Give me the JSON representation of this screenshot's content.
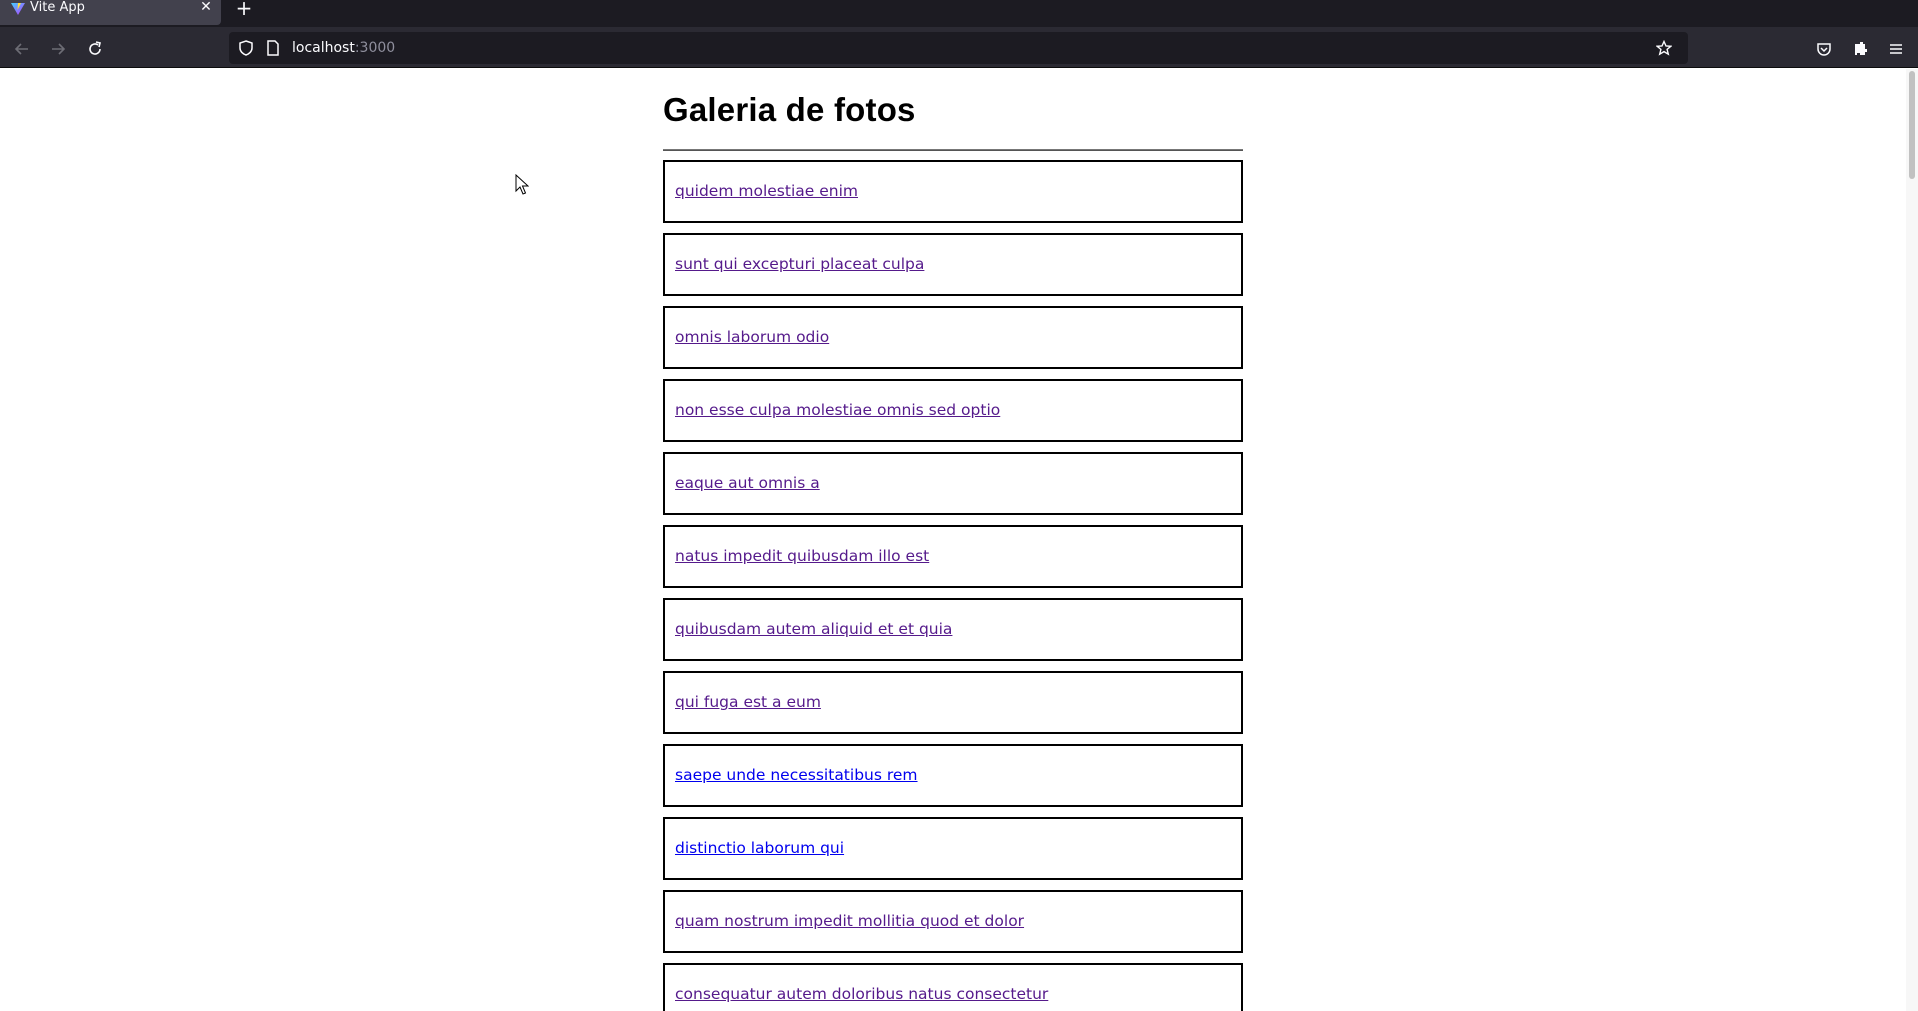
{
  "browser": {
    "tab_title": "Vite App",
    "tab_close_glyph": "✕",
    "new_tab_glyph": "+",
    "url_host": "localhost",
    "url_port": ":3000",
    "icons": {
      "favicon": "vite-logo-icon",
      "back": "back-arrow-icon",
      "forward": "forward-arrow-icon",
      "reload": "reload-icon",
      "site_info": "shield-icon",
      "page": "page-icon",
      "bookmark": "star-icon",
      "pocket": "pocket-icon",
      "extensions": "extensions-icon",
      "menu": "hamburger-menu-icon"
    },
    "colors": {
      "chrome_dark": "#1c1b22",
      "toolbar": "#2b2a33",
      "active_tab": "#42414d",
      "chrome_text": "#fbfbfe"
    }
  },
  "page": {
    "title": "Galeria de fotos",
    "link_colors": {
      "visited": "#551a8b",
      "unvisited": "#0000ee"
    },
    "albums": [
      {
        "title": "quidem molestiae enim",
        "visited": true
      },
      {
        "title": "sunt qui excepturi placeat culpa",
        "visited": true
      },
      {
        "title": "omnis laborum odio",
        "visited": true
      },
      {
        "title": "non esse culpa molestiae omnis sed optio",
        "visited": true
      },
      {
        "title": "eaque aut omnis a",
        "visited": true
      },
      {
        "title": "natus impedit quibusdam illo est",
        "visited": true
      },
      {
        "title": "quibusdam autem aliquid et et quia",
        "visited": true
      },
      {
        "title": "qui fuga est a eum",
        "visited": true
      },
      {
        "title": "saepe unde necessitatibus rem",
        "visited": false
      },
      {
        "title": "distinctio laborum qui",
        "visited": false
      },
      {
        "title": "quam nostrum impedit mollitia quod et dolor",
        "visited": true
      },
      {
        "title": "consequatur autem doloribus natus consectetur",
        "visited": true
      }
    ]
  }
}
